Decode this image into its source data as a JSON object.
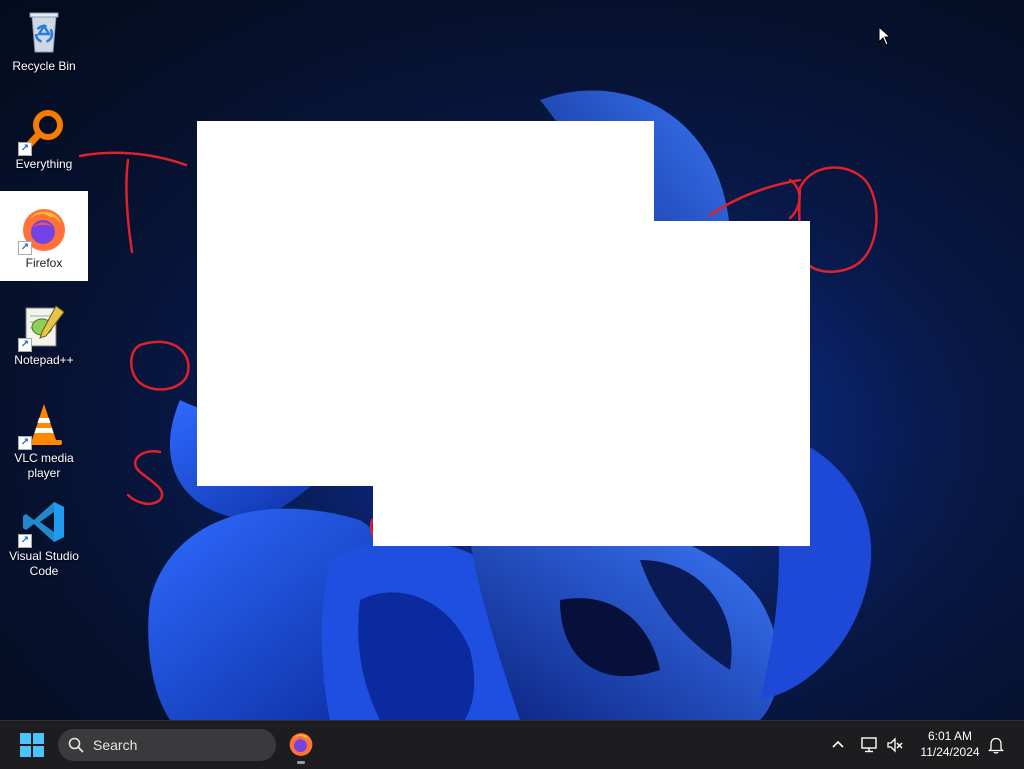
{
  "desktop_icons": [
    {
      "label": "Recycle Bin",
      "icon": "recycle-bin-icon",
      "shortcut": false
    },
    {
      "label": "Everything",
      "icon": "everything-search-icon",
      "shortcut": true
    },
    {
      "label": "Firefox",
      "icon": "firefox-icon",
      "shortcut": true,
      "selected": true
    },
    {
      "label": "Notepad++",
      "icon": "notepad-plus-plus-icon",
      "shortcut": true
    },
    {
      "label": "VLC media player",
      "icon": "vlc-icon",
      "shortcut": true
    },
    {
      "label": "Visual Studio Code",
      "icon": "vscode-icon",
      "shortcut": true
    }
  ],
  "taskbar": {
    "search_placeholder": "Search",
    "pinned": [
      {
        "name": "Firefox",
        "icon": "firefox-icon",
        "running": true
      }
    ],
    "tray_icons": [
      "chevron-up-icon",
      "network-icon",
      "volume-muted-icon",
      "notification-bell-icon"
    ],
    "clock": {
      "time": "6:01 AM",
      "date": "11/24/2024"
    }
  },
  "annotation_color": "#e0202a",
  "accent_color": "#1a5cff"
}
